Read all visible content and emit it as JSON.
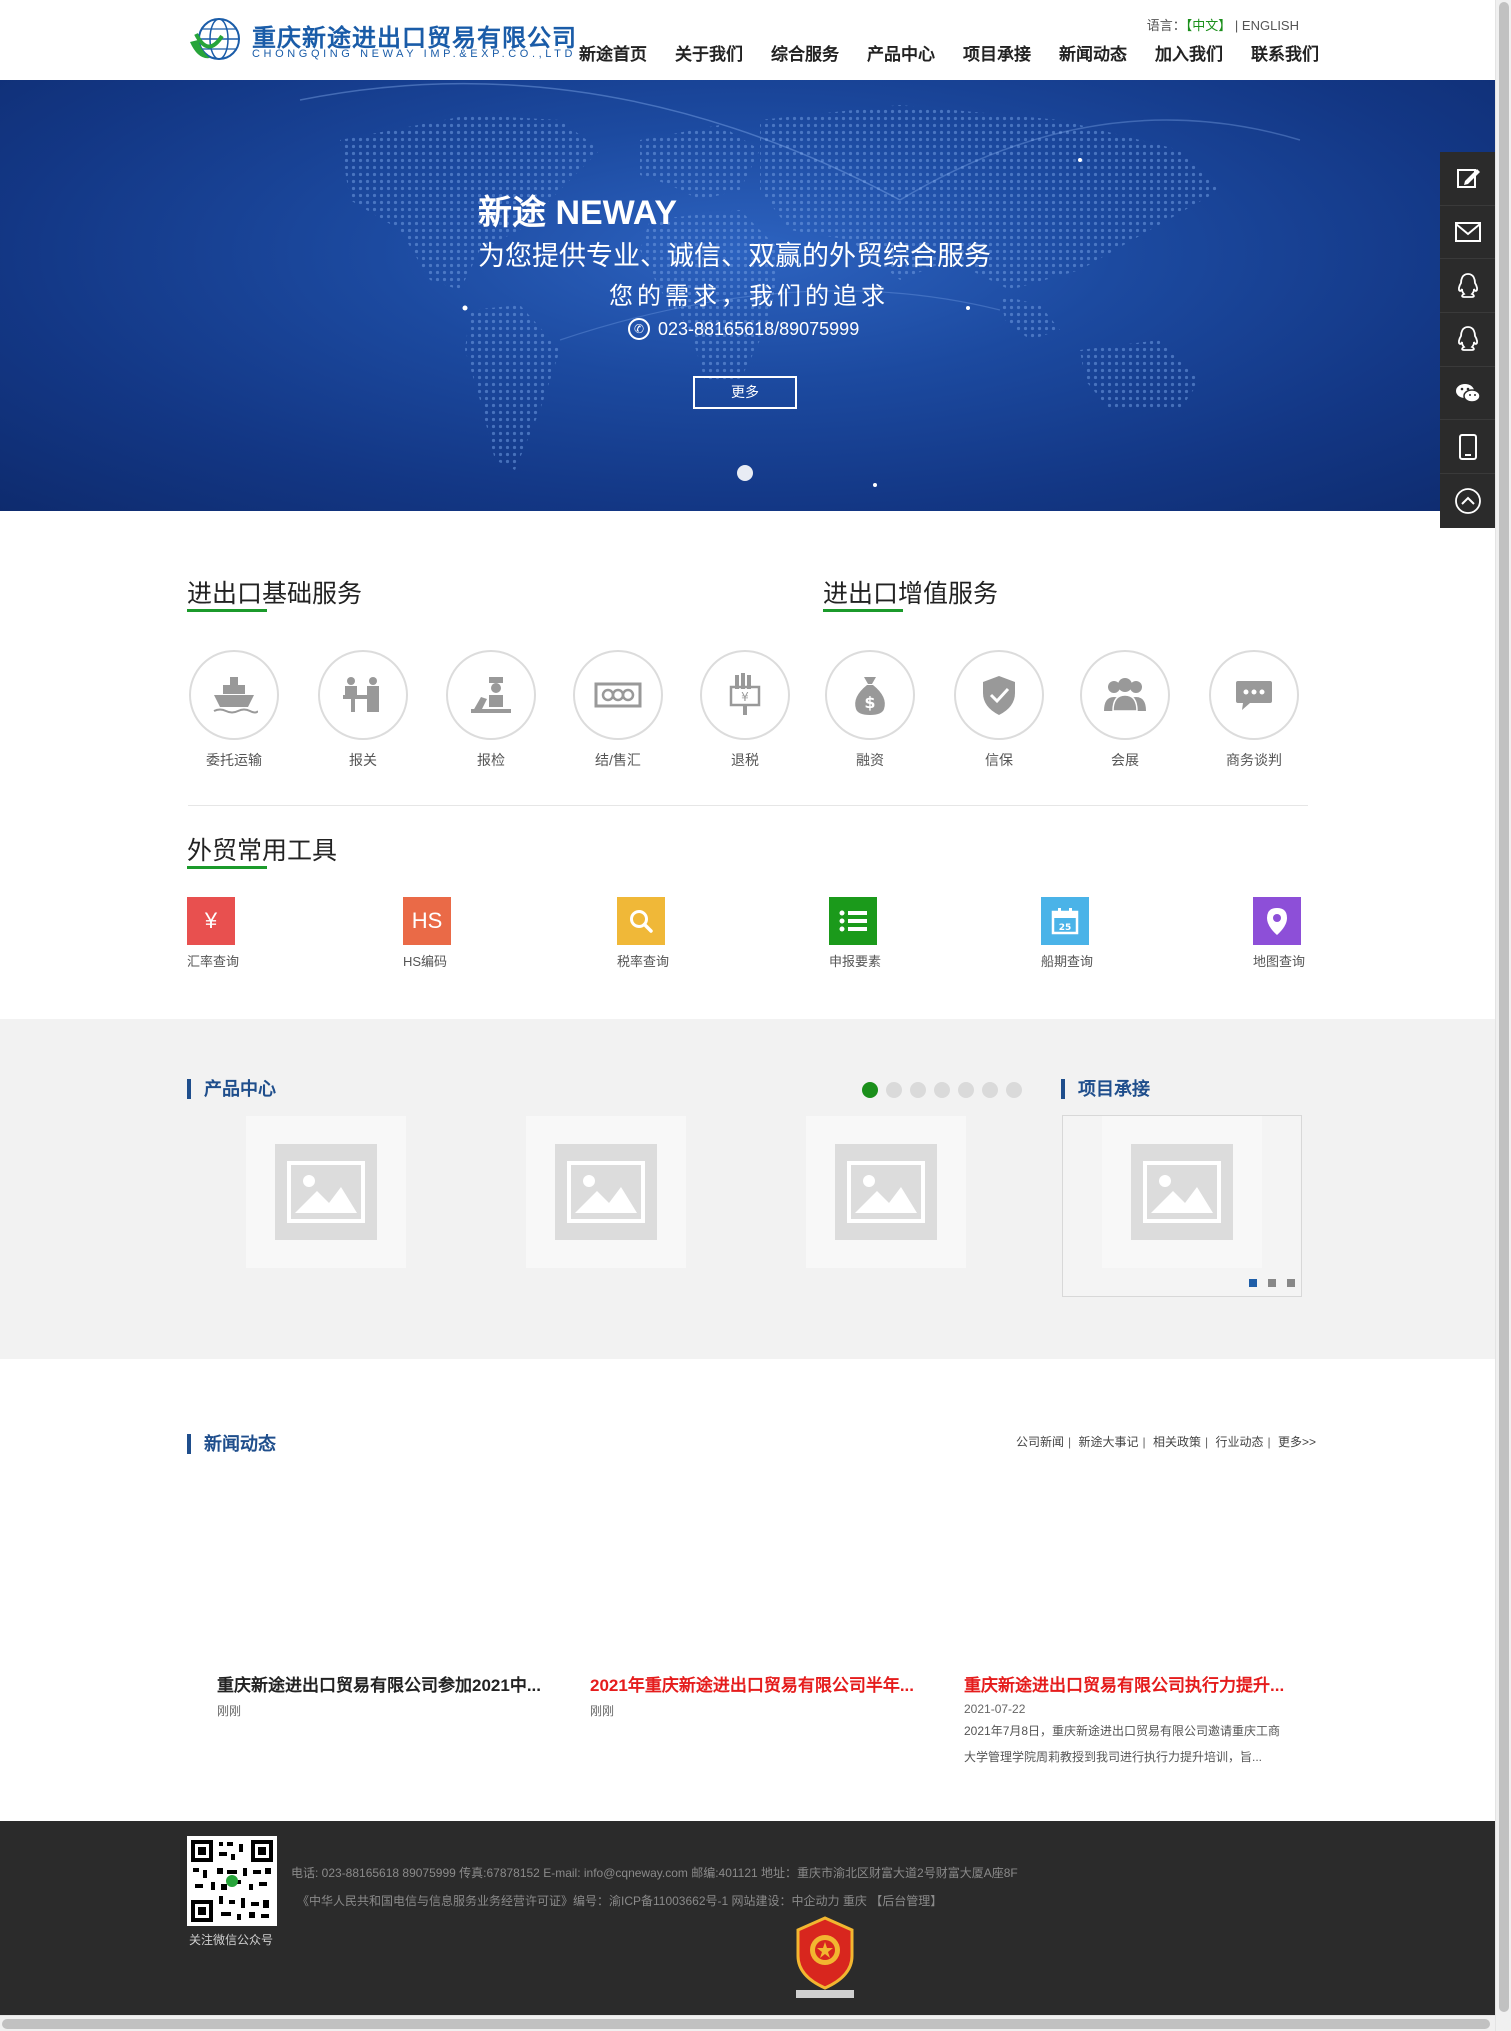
{
  "header": {
    "logo_cn": "重庆新途进出口贸易有限公司",
    "logo_en": "CHONGQING NEWAY IMP.&EXP.CO.,LTD",
    "lang_label": "语言：",
    "lang_cn": "【中文】",
    "lang_sep": "|",
    "lang_en": "ENGLISH",
    "nav": [
      "新途首页",
      "关于我们",
      "综合服务",
      "产品中心",
      "项目承接",
      "新闻动态",
      "加入我们",
      "联系我们"
    ]
  },
  "banner": {
    "title": "新途 NEWAY",
    "subtitle1": "为您提供专业、诚信、双赢的外贸综合服务",
    "subtitle2": "您的需求，我们的追求",
    "phone": "023-88165618/89075999",
    "more": "更多"
  },
  "float_bar": [
    "edit-icon",
    "mail-icon",
    "qq-icon",
    "qq-icon",
    "wechat-icon",
    "mobile-icon",
    "back-to-top-icon"
  ],
  "services": {
    "basic_title": "进出口基础服务",
    "value_title": "进出口增值服务",
    "basic": [
      "委托运输",
      "报关",
      "报检",
      "结/售汇",
      "退税"
    ],
    "value": [
      "融资",
      "信保",
      "会展",
      "商务谈判"
    ]
  },
  "tools": {
    "title": "外贸常用工具",
    "items": [
      {
        "label": "汇率查询",
        "glyph": "¥",
        "color": "#e8504f"
      },
      {
        "label": "HS编码",
        "glyph": "HS",
        "color": "#ea6a47"
      },
      {
        "label": "税率查询",
        "glyph": "",
        "color": "#f0b838"
      },
      {
        "label": "申报要素",
        "glyph": "",
        "color": "#1b9a1b"
      },
      {
        "label": "船期查询",
        "glyph": "25",
        "color": "#4ab3e8"
      },
      {
        "label": "地图查询",
        "glyph": "",
        "color": "#8d4fd8"
      }
    ]
  },
  "products": {
    "title": "产品中心",
    "dots": 7,
    "active_dot": 0
  },
  "projects": {
    "title": "项目承接",
    "dots": 3,
    "active_dot": 0
  },
  "news": {
    "title": "新闻动态",
    "links": [
      "公司新闻",
      "新途大事记",
      "相关政策",
      "行业动态",
      "更多>>"
    ],
    "items": [
      {
        "title": "重庆新途进出口贸易有限公司参加2021中...",
        "date": "刚刚",
        "color": "#222222"
      },
      {
        "title": "2021年重庆新途进出口贸易有限公司半年...",
        "date": "刚刚",
        "color": "#e51c1c"
      },
      {
        "title": "重庆新途进出口贸易有限公司执行力提升...",
        "date": "2021-07-22",
        "color": "#e51c1c",
        "summary": "2021年7月8日，重庆新途进出口贸易有限公司邀请重庆工商大学管理学院周莉教授到我司进行执行力提升培训，旨..."
      }
    ]
  },
  "footer": {
    "qr_label": "关注微信公众号",
    "line1": "电话: 023-88165618 89075999    传真:67878152 E-mail: info@cqneway.com     邮编:401121     地址：重庆市渝北区财富大道2号财富大厦A座8F",
    "line2_main": "《中华人民共和国电信与信息服务业务经营许可证》编号：渝ICP备11003662号-1   网站建设：中企动力 重庆",
    "line2_admin": "【后台管理】"
  }
}
